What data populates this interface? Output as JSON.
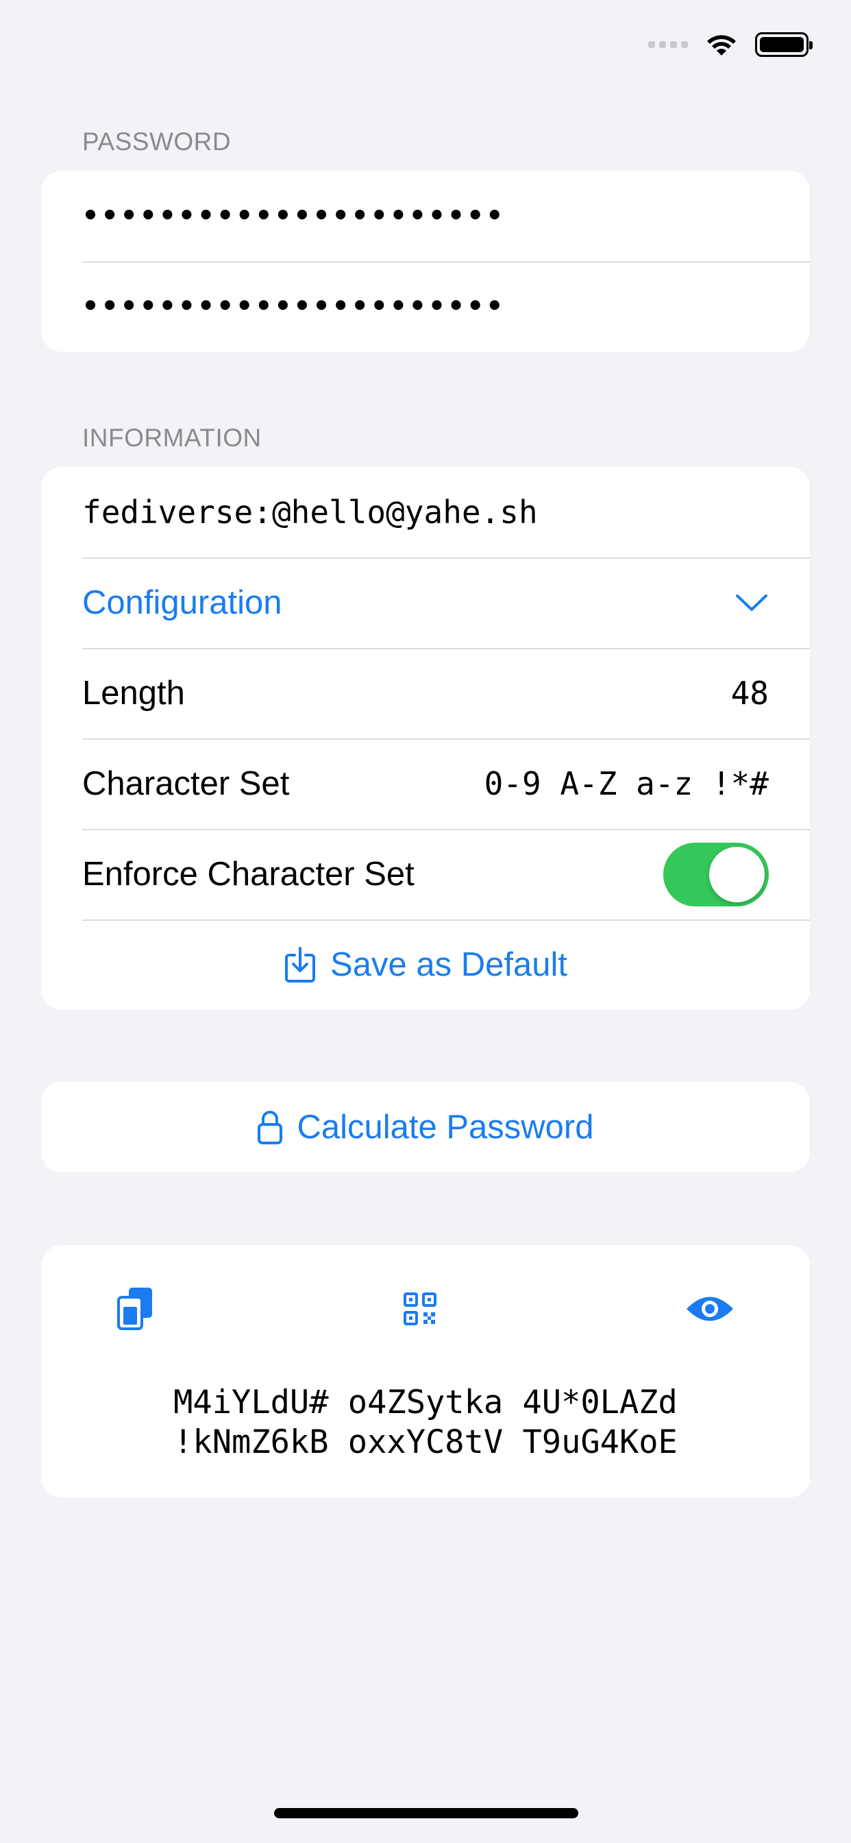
{
  "password_section": {
    "header": "PASSWORD",
    "field1_value": "••••••••••••••••••••••",
    "field2_value": "••••••••••••••••••••••"
  },
  "information_section": {
    "header": "INFORMATION",
    "identifier": "fediverse:@hello@yahe.sh",
    "configuration_label": "Configuration",
    "length_label": "Length",
    "length_value": "48",
    "charset_label": "Character Set",
    "charset_value": "0-9 A-Z a-z !*#",
    "enforce_label": "Enforce Character Set",
    "enforce_on": true,
    "save_default_label": "Save as Default"
  },
  "calculate": {
    "label": "Calculate Password"
  },
  "result": {
    "line1": "M4iYLdU# o4ZSytka 4U*0LAZd",
    "line2": "!kNmZ6kB oxxYC8tV T9uG4KoE",
    "icons": [
      "copy-icon",
      "qr-code-icon",
      "eye-icon"
    ]
  },
  "colors": {
    "accent": "#1a7cf0",
    "toggle_on": "#34c759",
    "background": "#f2f2f7"
  }
}
